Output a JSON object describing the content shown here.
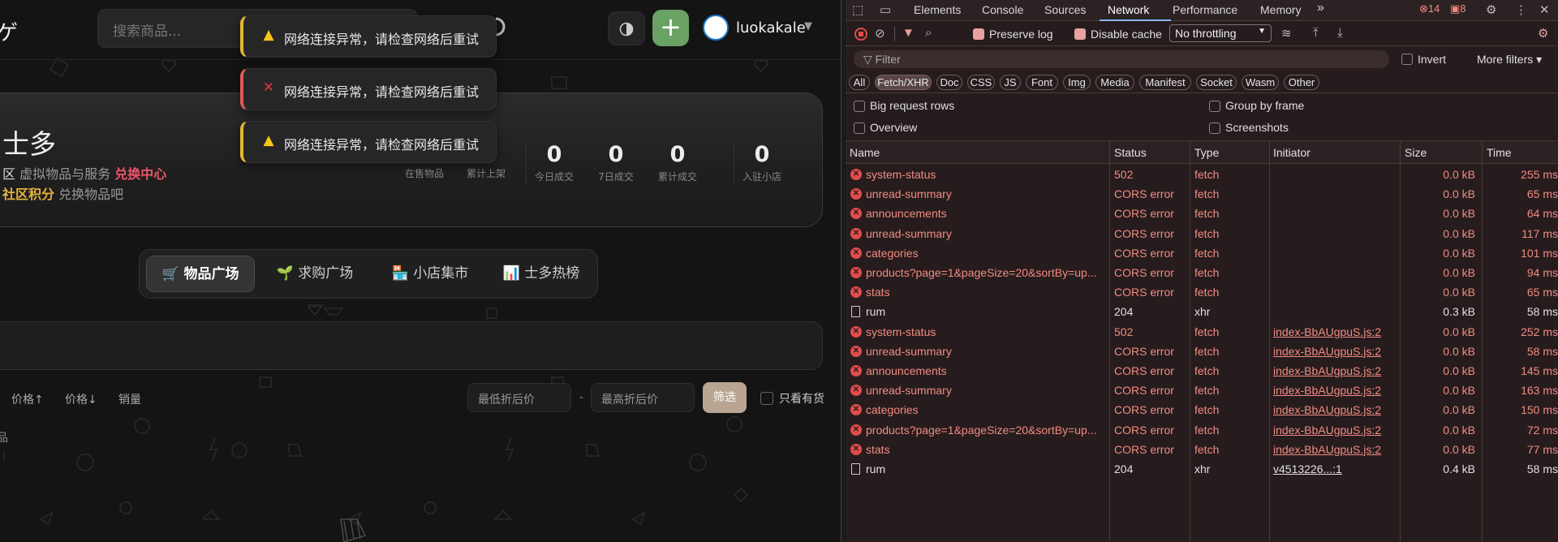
{
  "app": {
    "logo_fragment": "ゲ",
    "search_placeholder": "搜索商品...",
    "username": "luokakale",
    "hero": {
      "title": "士多",
      "line1_prefix": "区",
      "line1_text": "虚拟物品与服务",
      "line1_link": "兑换中心",
      "line2_prefix": "",
      "line2_link": "社区积分",
      "line2_text": "兑换物品吧",
      "stats": [
        {
          "value": "",
          "label": "在售物品"
        },
        {
          "value": "",
          "label": "累计上架"
        },
        {
          "value": "0",
          "label": "今日成交"
        },
        {
          "value": "0",
          "label": "7日成交"
        },
        {
          "value": "0",
          "label": "累计成交"
        },
        {
          "value": "0",
          "label": "入驻小店"
        }
      ]
    },
    "tabs": [
      {
        "icon": "🛒",
        "label": "物品广场",
        "active": true
      },
      {
        "icon": "🌱",
        "label": "求购广场",
        "active": false
      },
      {
        "icon": "🏪",
        "label": "小店集市",
        "active": false
      },
      {
        "icon": "📊",
        "label": "士多热榜",
        "active": false
      }
    ],
    "sort_options": [
      "价格↑",
      "价格↓",
      "销量"
    ],
    "min_price_placeholder": "最低折后价",
    "max_price_placeholder": "最高折后价",
    "price_dash": "-",
    "filter_button": "筛选",
    "in_stock_label": "只看有货",
    "cut_text": "品",
    "toasts": [
      {
        "type": "warning",
        "icon": "▲",
        "text": "网络连接异常，请检查网络后重试"
      },
      {
        "type": "error",
        "icon": "✕",
        "text": "网络连接异常，请检查网络后重试"
      },
      {
        "type": "warning",
        "icon": "▲",
        "text": "网络连接异常，请检查网络后重试"
      }
    ]
  },
  "devtools": {
    "tabs": [
      "Elements",
      "Console",
      "Sources",
      "Network",
      "Performance",
      "Memory"
    ],
    "active_tab": "Network",
    "more_tabs": "»",
    "error_count": "14",
    "warning_count": "8",
    "preserve_log": "Preserve log",
    "disable_cache": "Disable cache",
    "throttling": "No throttling",
    "filter_placeholder": "Filter",
    "invert": "Invert",
    "more_filters": "More filters",
    "type_chips": [
      "All",
      "Fetch/XHR",
      "Doc",
      "CSS",
      "JS",
      "Font",
      "Img",
      "Media",
      "Manifest",
      "Socket",
      "Wasm",
      "Other"
    ],
    "active_chip": "Fetch/XHR",
    "options": [
      "Big request rows",
      "Group by frame",
      "Overview",
      "Screenshots"
    ],
    "columns": [
      "Name",
      "Status",
      "Type",
      "Initiator",
      "Size",
      "Time"
    ],
    "rows": [
      {
        "name": "system-status",
        "status": "502",
        "type": "fetch",
        "initiator": "",
        "size": "0.0 kB",
        "time": "255 ms",
        "error": true
      },
      {
        "name": "unread-summary",
        "status": "CORS error",
        "type": "fetch",
        "initiator": "",
        "size": "0.0 kB",
        "time": "65 ms",
        "error": true
      },
      {
        "name": "announcements",
        "status": "CORS error",
        "type": "fetch",
        "initiator": "",
        "size": "0.0 kB",
        "time": "64 ms",
        "error": true
      },
      {
        "name": "unread-summary",
        "status": "CORS error",
        "type": "fetch",
        "initiator": "",
        "size": "0.0 kB",
        "time": "117 ms",
        "error": true
      },
      {
        "name": "categories",
        "status": "CORS error",
        "type": "fetch",
        "initiator": "",
        "size": "0.0 kB",
        "time": "101 ms",
        "error": true
      },
      {
        "name": "products?page=1&pageSize=20&sortBy=up...",
        "status": "CORS error",
        "type": "fetch",
        "initiator": "",
        "size": "0.0 kB",
        "time": "94 ms",
        "error": true
      },
      {
        "name": "stats",
        "status": "CORS error",
        "type": "fetch",
        "initiator": "",
        "size": "0.0 kB",
        "time": "65 ms",
        "error": true
      },
      {
        "name": "rum",
        "status": "204",
        "type": "xhr",
        "initiator": "",
        "size": "0.3 kB",
        "time": "58 ms",
        "error": false
      },
      {
        "name": "system-status",
        "status": "502",
        "type": "fetch",
        "initiator": "index-BbAUgpuS.js:2",
        "size": "0.0 kB",
        "time": "252 ms",
        "error": true
      },
      {
        "name": "unread-summary",
        "status": "CORS error",
        "type": "fetch",
        "initiator": "index-BbAUgpuS.js:2",
        "size": "0.0 kB",
        "time": "58 ms",
        "error": true
      },
      {
        "name": "announcements",
        "status": "CORS error",
        "type": "fetch",
        "initiator": "index-BbAUgpuS.js:2",
        "size": "0.0 kB",
        "time": "145 ms",
        "error": true
      },
      {
        "name": "unread-summary",
        "status": "CORS error",
        "type": "fetch",
        "initiator": "index-BbAUgpuS.js:2",
        "size": "0.0 kB",
        "time": "163 ms",
        "error": true
      },
      {
        "name": "categories",
        "status": "CORS error",
        "type": "fetch",
        "initiator": "index-BbAUgpuS.js:2",
        "size": "0.0 kB",
        "time": "150 ms",
        "error": true
      },
      {
        "name": "products?page=1&pageSize=20&sortBy=up...",
        "status": "CORS error",
        "type": "fetch",
        "initiator": "index-BbAUgpuS.js:2",
        "size": "0.0 kB",
        "time": "72 ms",
        "error": true
      },
      {
        "name": "stats",
        "status": "CORS error",
        "type": "fetch",
        "initiator": "index-BbAUgpuS.js:2",
        "size": "0.0 kB",
        "time": "77 ms",
        "error": true
      },
      {
        "name": "rum",
        "status": "204",
        "type": "xhr",
        "initiator": "v4513226...:1",
        "size": "0.4 kB",
        "time": "58 ms",
        "error": false
      }
    ]
  }
}
